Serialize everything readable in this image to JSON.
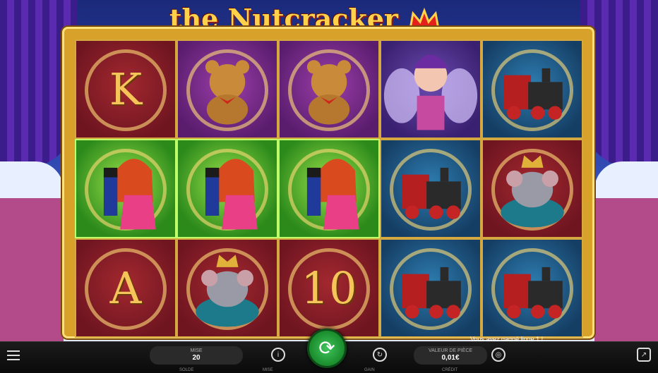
{
  "game": {
    "title": "the Nutcracker",
    "logo": "nutcracker-crown-logo"
  },
  "reels": [
    [
      {
        "symbol": "K",
        "bg": "red"
      },
      {
        "symbol": "nutcracker-girl",
        "bg": "green"
      },
      {
        "symbol": "A",
        "bg": "red"
      }
    ],
    [
      {
        "symbol": "teddy-bear",
        "bg": "purple"
      },
      {
        "symbol": "nutcracker-girl",
        "bg": "green"
      },
      {
        "symbol": "mouse-king",
        "bg": "red"
      }
    ],
    [
      {
        "symbol": "teddy-bear",
        "bg": "purple"
      },
      {
        "symbol": "nutcracker-girl",
        "bg": "green"
      },
      {
        "symbol": "10",
        "bg": "red"
      }
    ],
    [
      {
        "symbol": "sugar-plum-fairy",
        "bg": "pink"
      },
      {
        "symbol": "toy-train",
        "bg": "blue"
      },
      {
        "symbol": "toy-train",
        "bg": "blue"
      }
    ],
    [
      {
        "symbol": "toy-train",
        "bg": "blue"
      },
      {
        "symbol": "mouse-king",
        "bg": "blue"
      },
      {
        "symbol": "toy-train",
        "bg": "blue"
      }
    ]
  ],
  "controls": {
    "bet_label": "MISE",
    "bet_value": "20",
    "coin_label": "VALEUR DE PIÈCE",
    "coin_value": "0,01€",
    "win_message": "Vous avez gagné ligne 1 !"
  },
  "footer": {
    "solde": "SOLDE",
    "mise": "MISE",
    "gain": "GAIN",
    "credit": "CRÉDIT"
  },
  "colors": {
    "spin_button": "#1a8b2c",
    "frame_gold": "#d8a12a",
    "winning_glow": "#9be24a"
  }
}
